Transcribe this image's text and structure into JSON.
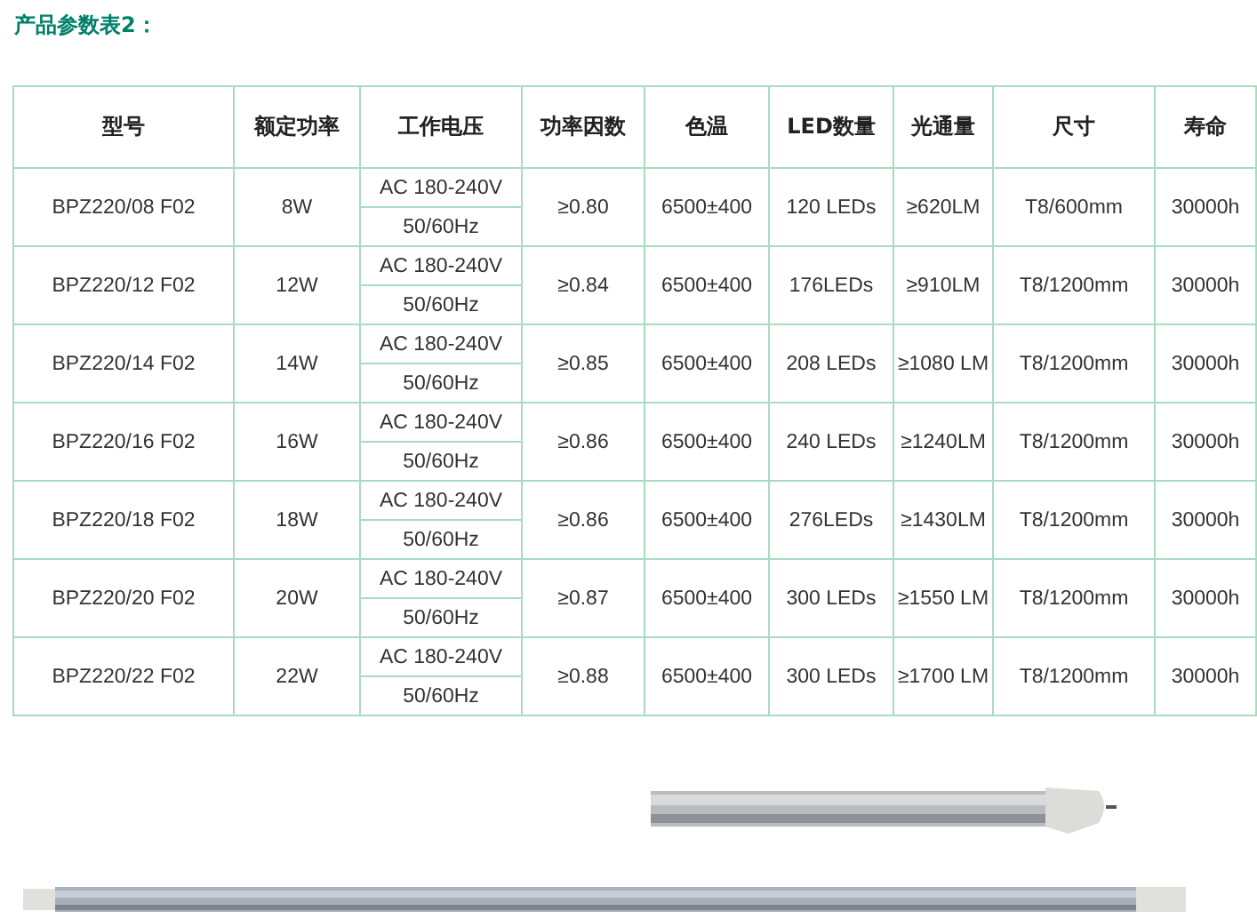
{
  "heading": "产品参数表2：",
  "table": {
    "columns": [
      "型号",
      "额定功率",
      "工作电压",
      "功率因数",
      "色温",
      "LED数量",
      "光通量",
      "尺寸",
      "寿命"
    ],
    "rows": [
      {
        "model": "BPZ220/08 F02",
        "power": "8W",
        "voltage": [
          "AC 180-240V",
          "50/60Hz"
        ],
        "pf": "≥0.80",
        "cct": "6500±400",
        "leds": "120 LEDs",
        "flux": "≥620LM",
        "size": "T8/600mm",
        "life": "30000h"
      },
      {
        "model": "BPZ220/12 F02",
        "power": "12W",
        "voltage": [
          "AC 180-240V",
          "50/60Hz"
        ],
        "pf": "≥0.84",
        "cct": "6500±400",
        "leds": "176LEDs",
        "flux": "≥910LM",
        "size": "T8/1200mm",
        "life": "30000h"
      },
      {
        "model": "BPZ220/14 F02",
        "power": "14W",
        "voltage": [
          "AC 180-240V",
          "50/60Hz"
        ],
        "pf": "≥0.85",
        "cct": "6500±400",
        "leds": "208 LEDs",
        "flux": "≥1080 LM",
        "size": "T8/1200mm",
        "life": "30000h"
      },
      {
        "model": "BPZ220/16 F02",
        "power": "16W",
        "voltage": [
          "AC 180-240V",
          "50/60Hz"
        ],
        "pf": "≥0.86",
        "cct": "6500±400",
        "leds": "240 LEDs",
        "flux": "≥1240LM",
        "size": "T8/1200mm",
        "life": "30000h"
      },
      {
        "model": "BPZ220/18 F02",
        "power": "18W",
        "voltage": [
          "AC 180-240V",
          "50/60Hz"
        ],
        "pf": "≥0.86",
        "cct": "6500±400",
        "leds": "276LEDs",
        "flux": "≥1430LM",
        "size": "T8/1200mm",
        "life": "30000h"
      },
      {
        "model": "BPZ220/20 F02",
        "power": "20W",
        "voltage": [
          "AC 180-240V",
          "50/60Hz"
        ],
        "pf": "≥0.87",
        "cct": "6500±400",
        "leds": "300 LEDs",
        "flux": "≥1550 LM",
        "size": "T8/1200mm",
        "life": "30000h"
      },
      {
        "model": "BPZ220/22 F02",
        "power": "22W",
        "voltage": [
          "AC 180-240V",
          "50/60Hz"
        ],
        "pf": "≥0.88",
        "cct": "6500±400",
        "leds": "300 LEDs",
        "flux": "≥1700 LM",
        "size": "T8/1200mm",
        "life": "30000h"
      }
    ]
  }
}
